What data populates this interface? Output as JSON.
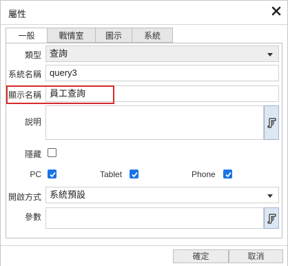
{
  "dialog": {
    "title": "屬性"
  },
  "tabs": [
    {
      "label": "一般"
    },
    {
      "label": "戰情室"
    },
    {
      "label": "圖示"
    },
    {
      "label": "系統"
    }
  ],
  "form": {
    "type_label": "類型",
    "type_value": "查詢",
    "system_name_label": "系統名稱",
    "system_name_value": "query3",
    "display_name_label": "顯示名稱",
    "display_name_value": "員工查詢",
    "description_label": "說明",
    "hidden_label": "隱藏",
    "hidden_checked": false,
    "pc_label": "PC",
    "pc_checked": true,
    "tablet_label": "Tablet",
    "tablet_checked": true,
    "phone_label": "Phone",
    "phone_checked": true,
    "open_mode_label": "開啟方式",
    "open_mode_value": "系統預設",
    "params_label": "參數"
  },
  "buttons": {
    "ok": "確定",
    "cancel": "取消"
  },
  "colors": {
    "checkbox": "#1a73e8",
    "highlight": "#d62a2a"
  },
  "icons": {
    "close": "close-icon",
    "edit": "script-edit-icon",
    "dropdown": "chevron-down-icon",
    "check": "check-icon"
  }
}
